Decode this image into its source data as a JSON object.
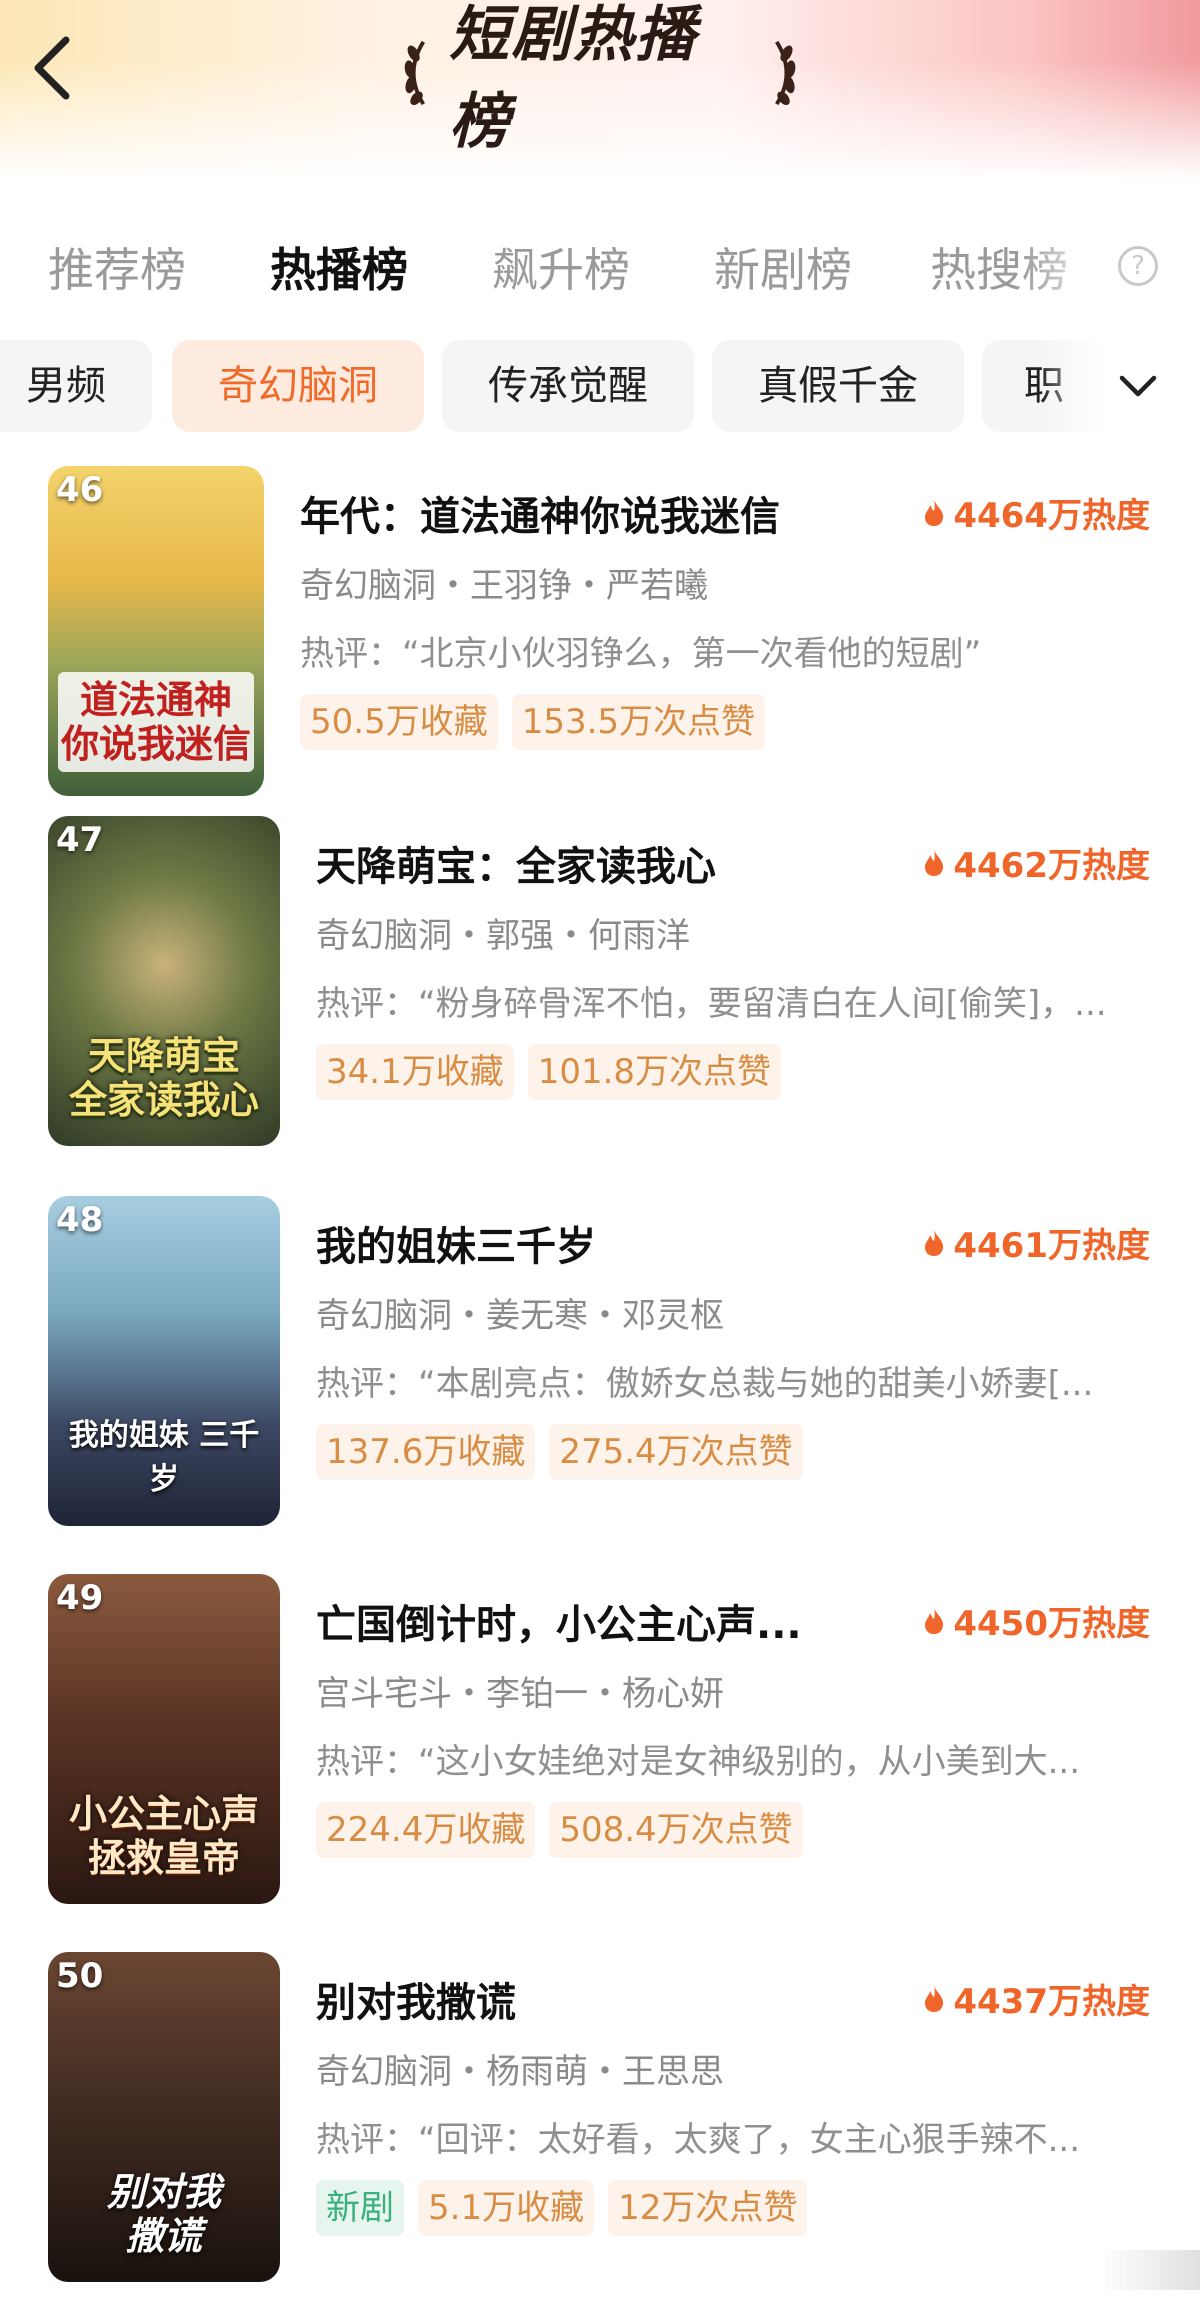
{
  "header": {
    "title": "短剧热播榜"
  },
  "tabs": [
    {
      "label": "推荐榜",
      "active": false
    },
    {
      "label": "热播榜",
      "active": true
    },
    {
      "label": "飙升榜",
      "active": false
    },
    {
      "label": "新剧榜",
      "active": false
    },
    {
      "label": "热搜榜",
      "active": false
    }
  ],
  "chips": [
    {
      "label": "男频",
      "active": false
    },
    {
      "label": "奇幻脑洞",
      "active": true
    },
    {
      "label": "传承觉醒",
      "active": false
    },
    {
      "label": "真假千金",
      "active": false
    },
    {
      "label": "职",
      "active": false
    }
  ],
  "items": [
    {
      "rank": "46",
      "title": "年代：道法通神你说我迷信",
      "heat": "4464万热度",
      "meta": "奇幻脑洞・王羽铮・严若曦",
      "review": "热评：“北京小伙羽铮么，第一次看他的短剧”",
      "tags": [
        "50.5万收藏",
        "153.5万次点赞"
      ],
      "poster_text": "道法通神\n你说我迷信",
      "poster_colors": [
        "#e8b84a",
        "#5d7a3a"
      ]
    },
    {
      "rank": "47",
      "title": "天降萌宝：全家读我心",
      "heat": "4462万热度",
      "meta": "奇幻脑洞・郭强・何雨洋",
      "review": "热评：“粉身碎骨浑不怕，要留清白在人间[偷笑]，...",
      "tags": [
        "34.1万收藏",
        "101.8万次点赞"
      ],
      "poster_text": "天降萌宝\n全家读我心",
      "poster_colors": [
        "#3c4a2e",
        "#7b8a4c"
      ]
    },
    {
      "rank": "48",
      "title": "我的姐妹三千岁",
      "heat": "4461万热度",
      "meta": "奇幻脑洞・姜无寒・邓灵枢",
      "review": "热评：“本剧亮点：傲娇女总裁与她的甜美小娇妻[...",
      "tags": [
        "137.6万收藏",
        "275.4万次点赞"
      ],
      "poster_text": "我的姐妹 三千岁",
      "poster_colors": [
        "#8fb7c9",
        "#3a3f56"
      ]
    },
    {
      "rank": "49",
      "title": "亡国倒计时，小公主心声...",
      "heat": "4450万热度",
      "meta": "宫斗宅斗・李铂一・杨心妍",
      "review": "热评：“这小女娃绝对是女神级别的，从小美到大...",
      "tags": [
        "224.4万收藏",
        "508.4万次点赞"
      ],
      "poster_text": "小公主心声\n拯救皇帝",
      "poster_colors": [
        "#6b3a2a",
        "#241512"
      ]
    },
    {
      "rank": "50",
      "title": "别对我撒谎",
      "heat": "4437万热度",
      "meta": "奇幻脑洞・杨雨萌・王思思",
      "review": "热评：“回评：太好看，太爽了，女主心狠手辣不...",
      "new_label": "新剧",
      "tags": [
        "5.1万收藏",
        "12万次点赞"
      ],
      "poster_text": "别对我\n撒谎",
      "poster_colors": [
        "#5a3a2a",
        "#1f1410"
      ]
    }
  ],
  "icons": {
    "back": "back-arrow-icon",
    "laurel": "laurel-icon",
    "help": "help-circle-icon",
    "flame": "flame-icon",
    "chevron": "chevron-down-icon"
  },
  "colors": {
    "accent": "#f06a2a",
    "tag_text": "#d98d44",
    "new_tag": "#3ab07a"
  }
}
